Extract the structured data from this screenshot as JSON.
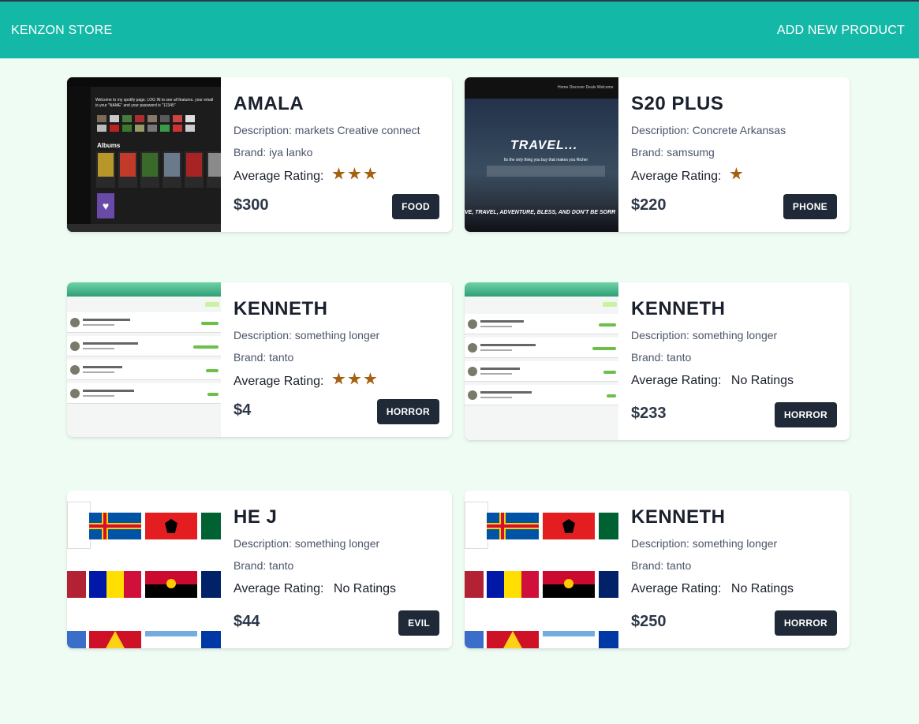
{
  "header": {
    "brand": "KENZON STORE",
    "add_product": "ADD NEW PRODUCT"
  },
  "labels": {
    "description_prefix": "Description: ",
    "brand_prefix": "Brand: ",
    "rating_label": "Average Rating:"
  },
  "colors": {
    "header": "#14b8a6",
    "background": "#effcf3",
    "star": "#a55f0e",
    "button": "#1f2937"
  },
  "products": [
    {
      "name": "AMALA",
      "description": "Description: markets Creative connect",
      "brand": "Brand: iya lanko",
      "rating_stars": 3,
      "rating_text": "",
      "price": "$300",
      "category": "FOOD",
      "thumb": {
        "icon": "music-app-screenshot",
        "caption": "Welcome to my spotify page. LOG IN to see all features. your email is your \"NAME\" and your password is \"12345\"",
        "section": "Albums"
      }
    },
    {
      "name": "S20 PLUS",
      "description": "Description: Concrete Arkansas",
      "brand": "Brand: samsumg",
      "rating_stars": 1,
      "rating_text": "",
      "price": "$220",
      "category": "PHONE",
      "thumb": {
        "icon": "travel-site-screenshot",
        "headline": "TRAVEL...",
        "tagline": "Its the only thing you buy that makes you Richer",
        "nav": "Home  Discover  Deals  Welcome",
        "footer": "VE, TRAVEL, ADVENTURE, BLESS, AND DON'T BE SORR"
      }
    },
    {
      "name": "KENNETH",
      "description": "Description: something longer",
      "brand": "Brand: tanto",
      "rating_stars": 3,
      "rating_text": "",
      "price": "$4",
      "category": "HORROR",
      "thumb": {
        "icon": "list-app-screenshot"
      }
    },
    {
      "name": "KENNETH",
      "description": "Description: something longer",
      "brand": "Brand: tanto",
      "rating_stars": 0,
      "rating_text": "No Ratings",
      "price": "$233",
      "category": "HORROR",
      "thumb": {
        "icon": "list-app-screenshot"
      }
    },
    {
      "name": "HE J",
      "description": "Description: something longer",
      "brand": "Brand: tanto",
      "rating_stars": 0,
      "rating_text": "No Ratings",
      "price": "$44",
      "category": "EVIL",
      "thumb": {
        "icon": "flags-app-screenshot"
      }
    },
    {
      "name": "KENNETH",
      "description": "Description: something longer",
      "brand": "Brand: tanto",
      "rating_stars": 0,
      "rating_text": "No Ratings",
      "price": "$250",
      "category": "HORROR",
      "thumb": {
        "icon": "flags-app-screenshot"
      }
    }
  ]
}
